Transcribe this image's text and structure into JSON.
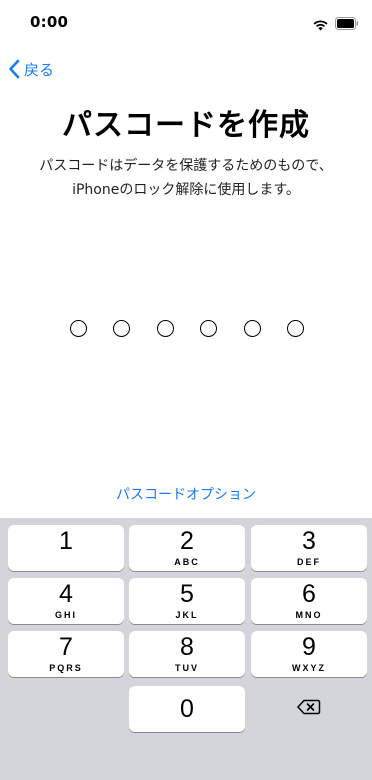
{
  "status_bar": {
    "time": "0:00"
  },
  "nav": {
    "back_label": "戻る"
  },
  "title": "パスコードを作成",
  "description": "パスコードはデータを保護するためのもので、iPhoneのロック解除に使用します。",
  "passcode_length": 6,
  "options_link": "パスコードオプション",
  "keypad": {
    "keys": [
      {
        "digit": "1",
        "letters": ""
      },
      {
        "digit": "2",
        "letters": "ABC"
      },
      {
        "digit": "3",
        "letters": "DEF"
      },
      {
        "digit": "4",
        "letters": "GHI"
      },
      {
        "digit": "5",
        "letters": "JKL"
      },
      {
        "digit": "6",
        "letters": "MNO"
      },
      {
        "digit": "7",
        "letters": "PQRS"
      },
      {
        "digit": "8",
        "letters": "TUV"
      },
      {
        "digit": "9",
        "letters": "WXYZ"
      },
      {
        "digit": "0",
        "letters": ""
      }
    ]
  },
  "colors": {
    "accent": "#1a7cf5",
    "keypad_background": "#d4d5da",
    "key_background": "#ffffff"
  }
}
